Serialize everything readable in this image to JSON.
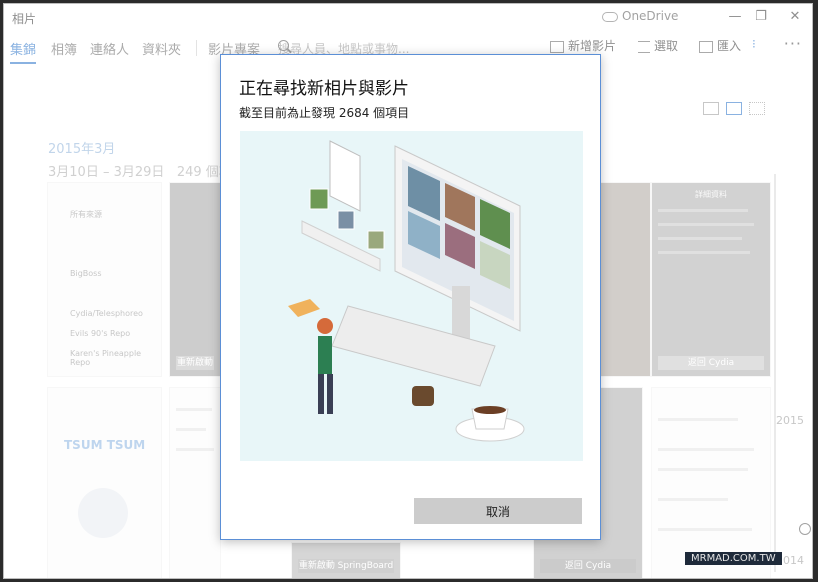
{
  "window": {
    "title": "相片"
  },
  "onedrive_label": "OneDrive",
  "window_controls": {
    "minimize": "—",
    "maximize": "❐",
    "close": "✕"
  },
  "nav": {
    "tabs": [
      {
        "label": "集錦",
        "active": true
      },
      {
        "label": "相簿",
        "active": false
      },
      {
        "label": "連絡人",
        "active": false
      },
      {
        "label": "資料夾",
        "active": false
      },
      {
        "label": "影片專案",
        "active": false
      }
    ],
    "search_placeholder": "搜尋人員、地點或事物..."
  },
  "toolbar": {
    "new_video": "新增影片",
    "select": "選取",
    "import": "匯入",
    "more": "···"
  },
  "collection": {
    "month": "2015年3月",
    "date_range": "3月10日 – 3月29日",
    "item_count": "249 個項目"
  },
  "thumbnail_text": {
    "restart": "重新啟動",
    "respring": "重新啟動 SpringBoard",
    "back_cydia": "返回 Cydia",
    "details": "詳細資料",
    "repo_1": "所有來源",
    "repo_2": "BigBoss",
    "repo_3": "Cydia/Telesphoreo",
    "repo_4": "Evils 90's Repo",
    "repo_5": "Karen's Pineapple Repo",
    "game_title": "TSUM TSUM"
  },
  "timeline": {
    "year_top": "2015",
    "year_bottom": "2014"
  },
  "dialog": {
    "title": "正在尋找新相片與影片",
    "subtitle": "截至目前為止發現 2684 個項目",
    "cancel_label": "取消"
  },
  "watermark": "MRMAD.COM.TW",
  "colors": {
    "accent": "#2a74c8",
    "dialog_border": "#5b8fd6",
    "illustration_bg": "#e8f6f8"
  }
}
